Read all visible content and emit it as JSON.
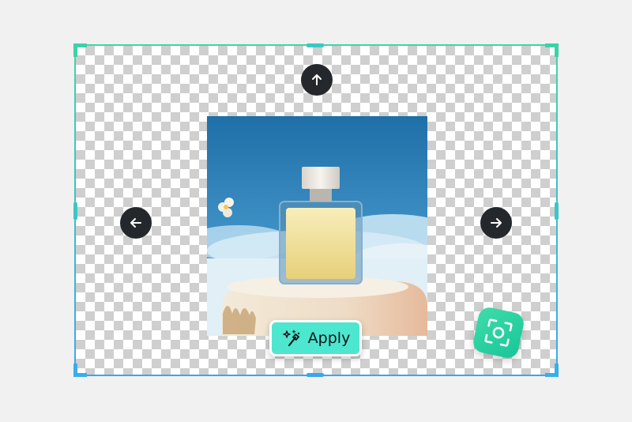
{
  "editor": {
    "apply_label": "Apply"
  },
  "icons": {
    "expand_up": "arrow-up-icon",
    "expand_left": "arrow-left-icon",
    "expand_right": "arrow-right-icon",
    "apply": "magic-wand-icon",
    "scan": "scan-focus-icon"
  },
  "colors": {
    "accent_teal": "#4de6cf",
    "frame_top": "#3fd6a6",
    "frame_bottom": "#39a7ee",
    "arrow_button": "#24282d",
    "scan_button": "#1fcb9c"
  }
}
